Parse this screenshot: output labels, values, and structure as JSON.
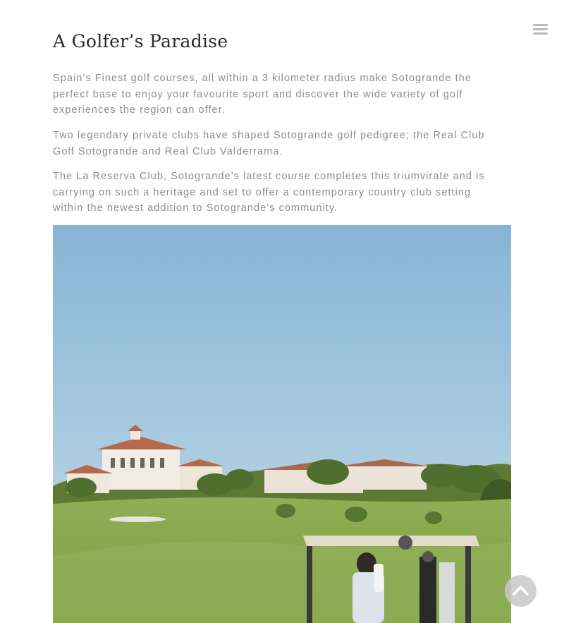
{
  "page": {
    "title": "A Golfer’s Paradise",
    "paragraphs": [
      "Spain’s Finest golf courses, all within a 3 kilometer radius make Sotogrande the perfect base to enjoy your favourite sport and discover the wide variety of golf experiences the region can offer.",
      "Two legendary private clubs have shaped Sotogrande golf pedigree; the Real Club Golf Sotogrande and Real Club Valderrama.",
      "The La Reserva Club, Sotogrande’s latest course completes this triumvirate and is carrying on such a heritage and set to offer a contemporary country club setting within the newest addition to Sotogrande’s community."
    ]
  },
  "header": {
    "menu_icon": "hamburger-menu-icon"
  },
  "controls": {
    "scroll_top_icon": "chevron-up-icon"
  },
  "colors": {
    "text": "#8c8c8c",
    "heading": "#2a2a2a",
    "sky_top": "#8ab6d6",
    "grass": "#86a94d"
  }
}
